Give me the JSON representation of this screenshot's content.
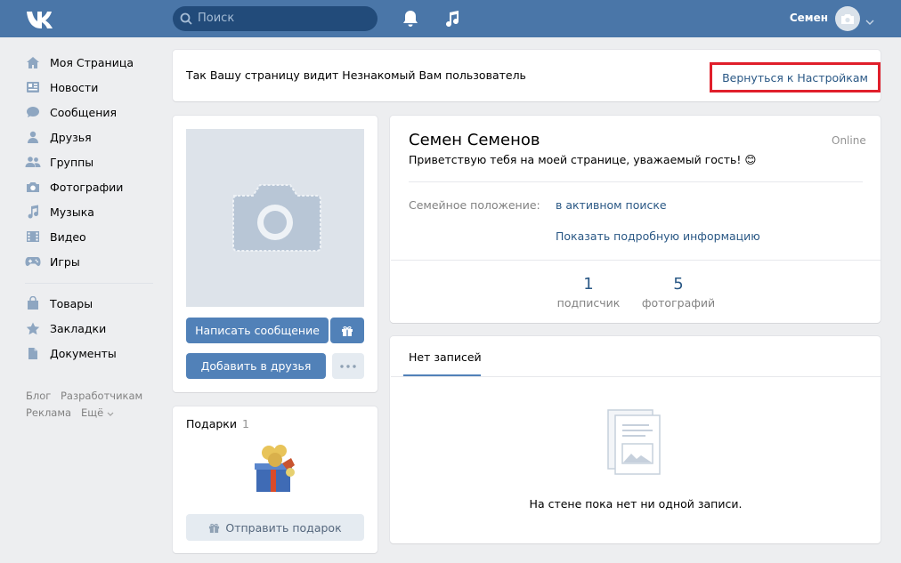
{
  "header": {
    "search_placeholder": "Поиск",
    "user_name": "Семен"
  },
  "sidebar": {
    "items": [
      {
        "label": "Моя Страница",
        "icon": "home-icon"
      },
      {
        "label": "Новости",
        "icon": "news-icon"
      },
      {
        "label": "Сообщения",
        "icon": "messages-icon"
      },
      {
        "label": "Друзья",
        "icon": "friend-icon"
      },
      {
        "label": "Группы",
        "icon": "groups-icon"
      },
      {
        "label": "Фотографии",
        "icon": "camera-icon"
      },
      {
        "label": "Музыка",
        "icon": "music-icon"
      },
      {
        "label": "Видео",
        "icon": "video-icon"
      },
      {
        "label": "Игры",
        "icon": "gamepad-icon"
      },
      {
        "label": "Товары",
        "icon": "bag-icon"
      },
      {
        "label": "Закладки",
        "icon": "star-icon"
      },
      {
        "label": "Документы",
        "icon": "document-icon"
      }
    ],
    "footer": {
      "blog": "Блог",
      "developers": "Разработчикам",
      "ads": "Реклама",
      "more": "Ещё"
    }
  },
  "banner": {
    "text": "Так Вашу страницу видит Незнакомый Вам пользователь",
    "back_label": "Вернуться к Настройкам"
  },
  "profile": {
    "write_message": "Написать сообщение",
    "add_friend": "Добавить в друзья",
    "name": "Семен Семенов",
    "online": "Online",
    "status": "Приветствую тебя на моей странице, уважаемый гость! 😊",
    "relationship_label": "Семейное положение:",
    "relationship_value": "в активном поиске",
    "show_more": "Показать подробную информацию",
    "counters": {
      "followers_num": "1",
      "followers_label": "подписчик",
      "photos_num": "5",
      "photos_label": "фотографий"
    }
  },
  "gifts": {
    "title": "Подарки",
    "count": "1",
    "send_label": "Отправить подарок"
  },
  "wall": {
    "tab": "Нет записей",
    "empty_text": "На стене пока нет ни одной записи."
  },
  "colors": {
    "header_bg": "#4a76a8",
    "accent": "#5181b8",
    "link": "#2a5885",
    "highlight_border": "#e01f2b"
  }
}
